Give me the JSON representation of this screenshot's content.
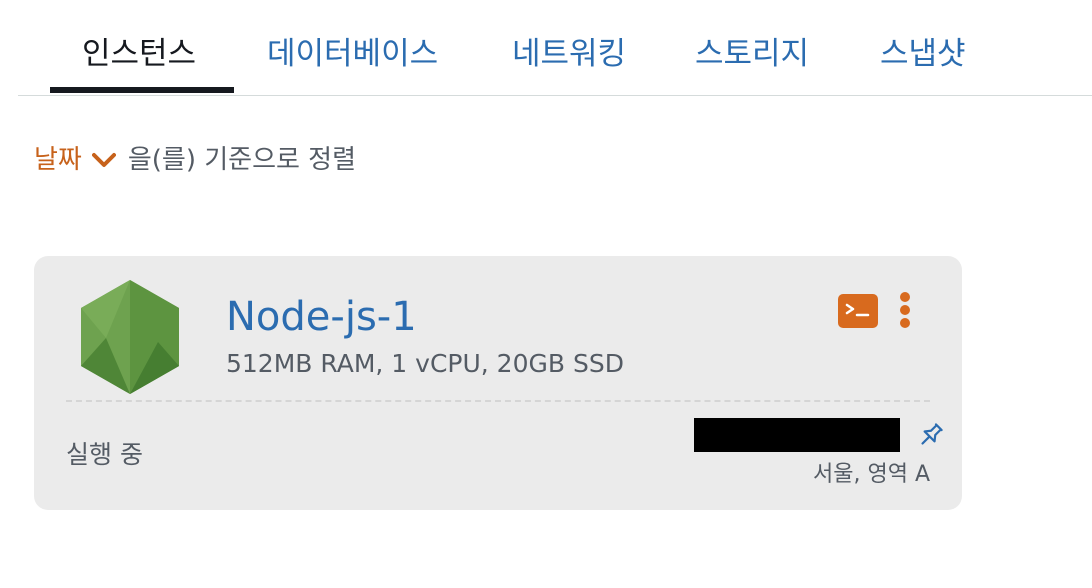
{
  "tabs": [
    {
      "label": "인스턴스",
      "active": true
    },
    {
      "label": "데이터베이스",
      "active": false
    },
    {
      "label": "네트워킹",
      "active": false
    },
    {
      "label": "스토리지",
      "active": false
    },
    {
      "label": "스냅샷",
      "active": false
    }
  ],
  "sort": {
    "field": "날짜",
    "suffix": "을(를) 기준으로 정렬"
  },
  "instance": {
    "name": "Node-js-1",
    "specs": "512MB RAM, 1 vCPU, 20GB SSD",
    "status": "실행 중",
    "region": "서울, 영역 A",
    "icon": "nodejs-logo"
  },
  "colors": {
    "accent": "#2b6cb0",
    "orange": "#d86a1e",
    "card_bg": "#ebebeb"
  }
}
